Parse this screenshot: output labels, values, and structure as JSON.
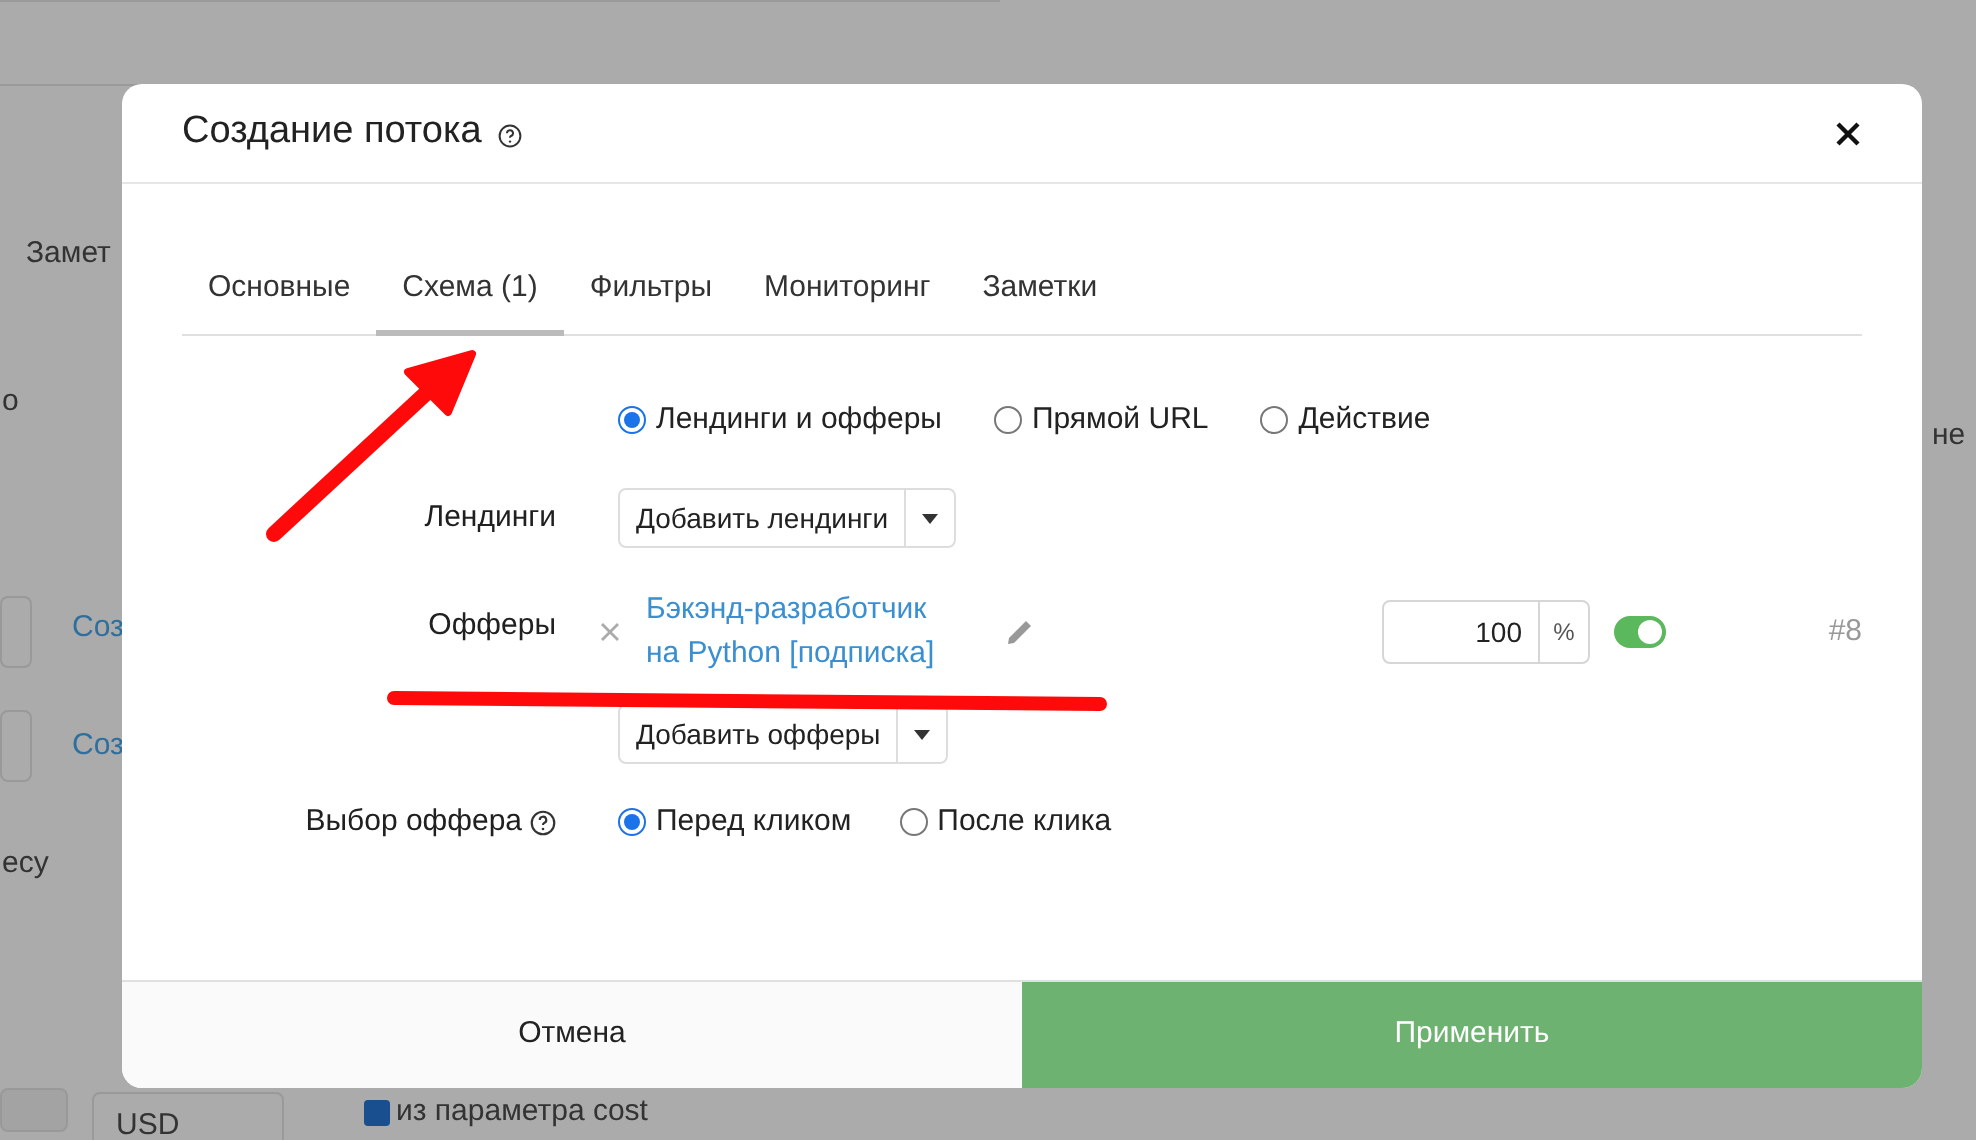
{
  "background": {
    "fragments": [
      {
        "kind": "text",
        "text": "Замет"
      },
      {
        "kind": "text",
        "text": "о"
      },
      {
        "kind": "link",
        "text": "Соз"
      },
      {
        "kind": "link",
        "text": "Соз"
      },
      {
        "kind": "text",
        "text": "есу"
      },
      {
        "kind": "select",
        "text": "USD"
      },
      {
        "kind": "checkbox",
        "text": "из параметра cost",
        "checked": true
      },
      {
        "kind": "text",
        "text": "не"
      }
    ]
  },
  "modal": {
    "title": "Создание потока",
    "tabs": [
      {
        "label": "Основные",
        "selected": false
      },
      {
        "label": "Схема (1)",
        "selected": true
      },
      {
        "label": "Фильтры",
        "selected": false
      },
      {
        "label": "Мониторинг",
        "selected": false
      },
      {
        "label": "Заметки",
        "selected": false
      }
    ],
    "scheme_options": [
      {
        "label": "Лендинги и офферы",
        "selected": true
      },
      {
        "label": "Прямой URL",
        "selected": false
      },
      {
        "label": "Действие",
        "selected": false
      }
    ],
    "landings": {
      "label": "Лендинги",
      "button": "Добавить лендинги"
    },
    "offers": {
      "label": "Офферы",
      "items": [
        {
          "name": "Бэкэнд-разработчик на Python [подписка]",
          "share": "100",
          "unit": "%",
          "enabled": true,
          "id": "#8"
        }
      ],
      "button": "Добавить офферы"
    },
    "offer_choice": {
      "label": "Выбор оффера",
      "options": [
        {
          "label": "Перед кликом",
          "selected": true
        },
        {
          "label": "После клика",
          "selected": false
        }
      ]
    },
    "footer": {
      "cancel": "Отмена",
      "apply": "Применить"
    }
  }
}
